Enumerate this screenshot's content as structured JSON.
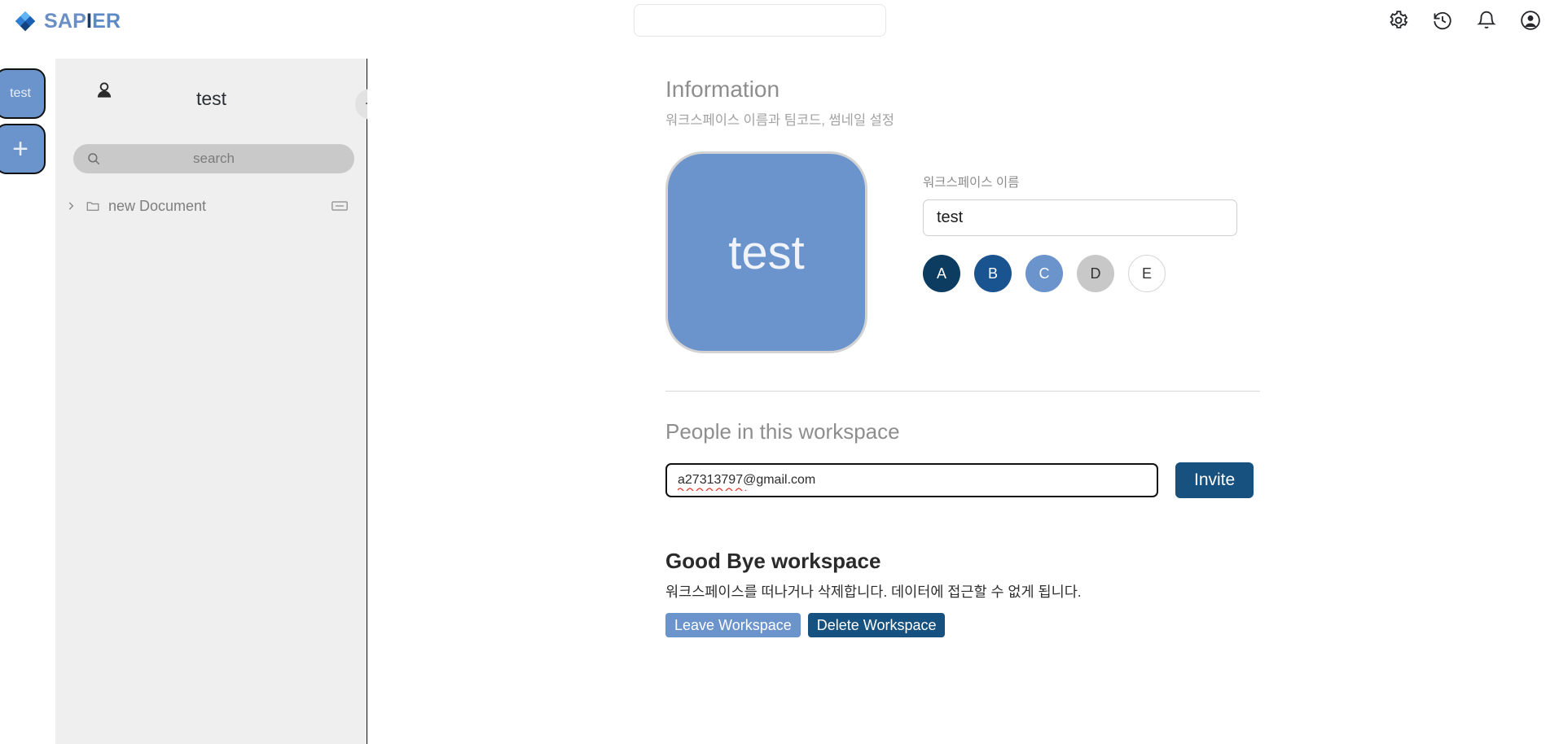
{
  "header": {
    "brand": {
      "part1": "SAP",
      "part2": "I",
      "part3": "ER",
      "icon": "gem-diamond-icon"
    },
    "search_value": "",
    "search_placeholder": "",
    "icons": [
      {
        "name": "gear-icon",
        "label": "Settings"
      },
      {
        "name": "history-icon",
        "label": "History"
      },
      {
        "name": "bell-icon",
        "label": "Notifications"
      },
      {
        "name": "account-circle-icon",
        "label": "Account"
      }
    ]
  },
  "rail": {
    "workspace_button": "test",
    "add_button": "+"
  },
  "sidebar": {
    "person_icon": "person-icon",
    "title": "test",
    "add_label": "+",
    "search_placeholder": "search",
    "search_icon": "search-icon",
    "tree": [
      {
        "label": "new Document",
        "chevron": "chevron-right-icon",
        "icon": "folder-icon",
        "trailing_icon": "rectangle-icon"
      }
    ]
  },
  "main": {
    "information": {
      "title": "Information",
      "subtitle": "워크스페이스 이름과 팀코드, 썸네일 설정",
      "thumbnail_text": "test",
      "thumbnail_color": "#6b93cc",
      "name_label": "워크스페이스 이름",
      "name_value": "test",
      "swatches": [
        {
          "label": "A",
          "color": "#0d3c61",
          "text_color": "#ffffff",
          "selected": false
        },
        {
          "label": "B",
          "color": "#1a5490",
          "text_color": "#ffffff",
          "selected": false
        },
        {
          "label": "C",
          "color": "#6b93cc",
          "text_color": "#ffffff",
          "selected": true
        },
        {
          "label": "D",
          "color": "#c8c8c8",
          "text_color": "#333333",
          "selected": false
        },
        {
          "label": "E",
          "color": "#ffffff",
          "text_color": "#333333",
          "selected": false
        }
      ]
    },
    "people": {
      "title": "People in this workspace",
      "email_value": "a27313797@gmail.com",
      "email_placeholder": "",
      "invite_label": "Invite"
    },
    "goodbye": {
      "title": "Good Bye workspace",
      "description": "워크스페이스를 떠나거나 삭제합니다. 데이터에 접근할 수 없게 됩니다.",
      "leave_label": "Leave Workspace",
      "delete_label": "Delete Workspace"
    }
  }
}
